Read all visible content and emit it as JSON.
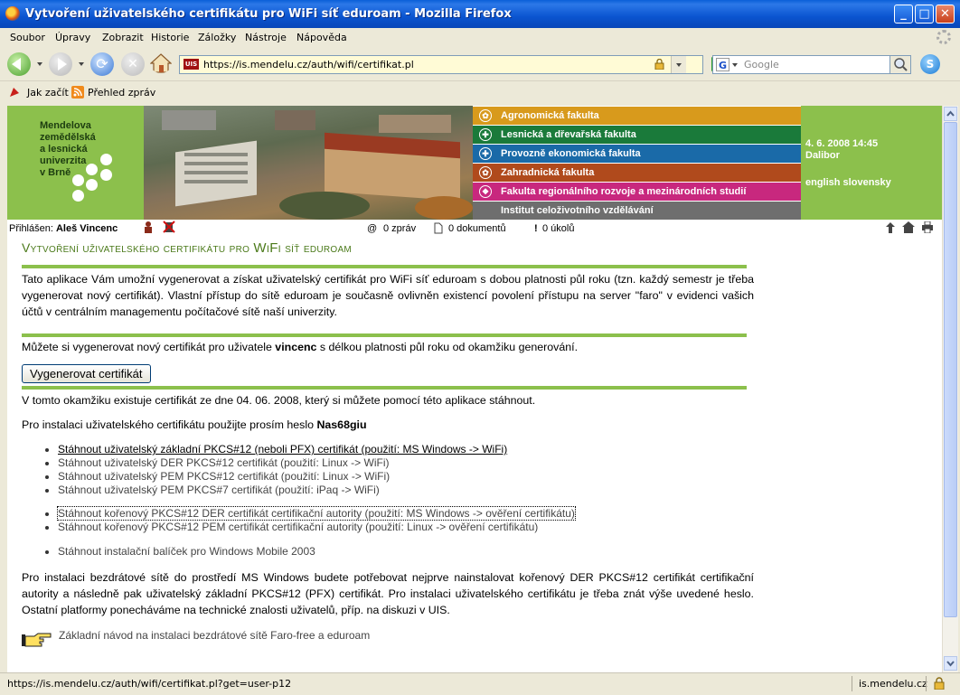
{
  "window": {
    "title": "Vytvoření uživatelského certifikátu pro WiFi síť eduroam - Mozilla Firefox",
    "min": "_",
    "max": "□",
    "close": "✕"
  },
  "menu": [
    "Soubor",
    "Úpravy",
    "Zobrazit",
    "Historie",
    "Záložky",
    "Nástroje",
    "Nápověda"
  ],
  "navbar": {
    "url": "https://is.mendelu.cz/auth/wifi/certifikat.pl",
    "favicon_text": "UIS",
    "search_engine": "G",
    "search_placeholder": "Google"
  },
  "bookmarks": [
    "Jak začít",
    "Přehled zpráv"
  ],
  "banner": {
    "logo_text": "Mendelova\nzemědělská\na lesnická\nuniverzita\nv Brně",
    "faculties": [
      {
        "label": "Agronomická fakulta",
        "color": "#d89a1c"
      },
      {
        "label": "Lesnická a dřevařská fakulta",
        "color": "#1a7a3a"
      },
      {
        "label": "Provozně ekonomická fakulta",
        "color": "#1a6aa8"
      },
      {
        "label": "Zahradnická fakulta",
        "color": "#b04a1c"
      },
      {
        "label": "Fakulta regionálního rozvoje a mezinárodních studií",
        "color": "#c8287e"
      },
      {
        "label": "Institut celoživotního vzdělávání",
        "color": "#6e6e6e"
      }
    ],
    "datetime": "4. 6. 2008  14:45",
    "user": "Dalibor",
    "languages": "english slovensky"
  },
  "infobar": {
    "logged_label": "Přihlášen:",
    "logged_user": "Aleš Vincenc",
    "messages": "0 zpráv",
    "documents": "0 dokumentů",
    "tasks": "0 úkolů"
  },
  "page": {
    "heading_part1": "Vytvoření uživatelského certifikátu pro ",
    "heading_wifi": "WiFi",
    "heading_part2": " síť eduroam",
    "intro": "Tato aplikace Vám umožní vygenerovat a získat uživatelský certifikát pro WiFi síť eduroam s dobou platnosti půl roku (tzn. každý semestr je třeba vygenerovat nový certifikát). Vlastní přístup do sítě eduroam je současně ovlivněn existencí povolení přístupu na server \"faro\" v evidenci vašich účtů v centrálním managementu počítačové sítě naší univerzity.",
    "generate_prefix": "Můžete si vygenerovat nový certifikát pro uživatele ",
    "generate_user": "vincenc",
    "generate_suffix": " s délkou platnosti půl roku od okamžiku generování.",
    "generate_button": "Vygenerovat certifikát",
    "exists_text": "V tomto okamžiku existuje certifikát ze dne 04. 06. 2008, který si můžete pomocí této aplikace stáhnout.",
    "password_prefix": "Pro instalaci uživatelského certifikátu použijte prosím heslo ",
    "password": "Nas68giu",
    "links_user": [
      "Stáhnout uživatelský základní PKCS#12 (neboli PFX) certifikát (použití: MS Windows -> WiFi)",
      "Stáhnout uživatelský DER PKCS#12 certifikát (použití: Linux -> WiFi)",
      "Stáhnout uživatelský PEM PKCS#12 certifikát (použití: Linux -> WiFi)",
      "Stáhnout uživatelský PEM PKCS#7 certifikát (použití: iPaq -> WiFi)"
    ],
    "links_root": [
      "Stáhnout kořenový PKCS#12 DER certifikát certifikační autority (použití: MS Windows -> ověření certifikátu)",
      "Stáhnout kořenový PKCS#12 PEM certifikát certifikační autority (použití: Linux -> ověření certifikátu)"
    ],
    "link_mobile": "Stáhnout instalační balíček pro Windows Mobile 2003",
    "final_text": "Pro instalaci bezdrátové sítě do prostředí MS Windows budete potřebovat nejprve nainstalovat kořenový DER PKCS#12 certifikát certifikační autority a následně pak uživatelský základní PKCS#12 (PFX) certifikát. Pro instalaci uživatelského certifikátu je třeba znát výše uvedené heslo. Ostatní platformy ponecháváme na technické znalosti uživatelů, příp. na diskuzi v UIS.",
    "guide_link": "Základní návod na instalaci bezdrátové sítě Faro-free a eduroam"
  },
  "status": {
    "text": "https://is.mendelu.cz/auth/wifi/certifikat.pl?get=user-p12",
    "domain": "is.mendelu.cz"
  }
}
